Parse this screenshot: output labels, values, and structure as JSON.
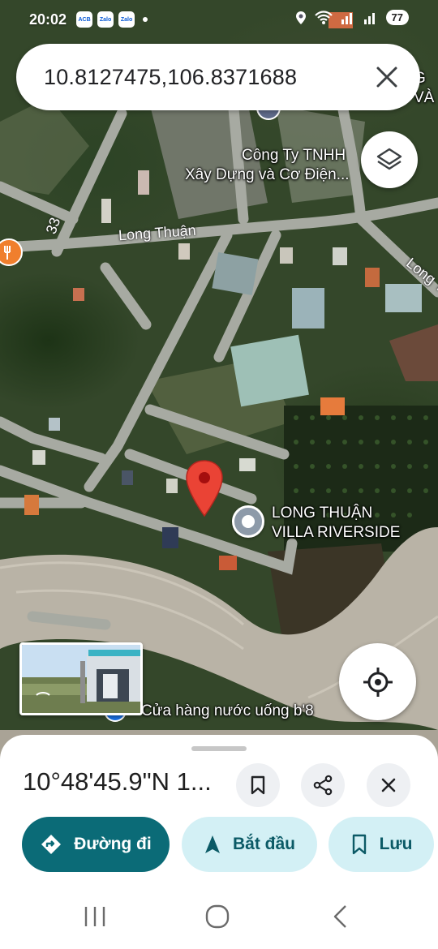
{
  "status_bar": {
    "time": "20:02",
    "apps": [
      "ACB",
      "Zalo",
      "Zalo"
    ],
    "battery": "77"
  },
  "search": {
    "query": "10.8127475,106.8371688"
  },
  "map": {
    "places": [
      {
        "name_line1": "Công Ty TNHH",
        "name_line2": "Xây Dựng và Cơ Điện..."
      },
      {
        "name_line1": "LONG THUẬN",
        "name_line2": "VILLA RIVERSIDE"
      },
      {
        "name_line1": "Cửa hàng nước uống b'8"
      }
    ],
    "roads": [
      "Long Thuận",
      "Long Th",
      "33"
    ],
    "edge_text": [
      "G",
      "VÀ"
    ]
  },
  "sheet": {
    "coordinates": "10°48'45.9\"N 1...",
    "buttons": {
      "directions": "Đường đi",
      "start": "Bắt đầu",
      "save": "Lưu"
    }
  },
  "colors": {
    "primary": "#0b6b77",
    "secondary_bg": "#d3f0f5",
    "pin": "#ea4335"
  },
  "icons": [
    "close-icon",
    "layers-icon",
    "my-location-icon",
    "bookmark-icon",
    "share-icon",
    "directions-icon",
    "navigation-icon",
    "recents-icon",
    "home-icon",
    "back-icon"
  ]
}
